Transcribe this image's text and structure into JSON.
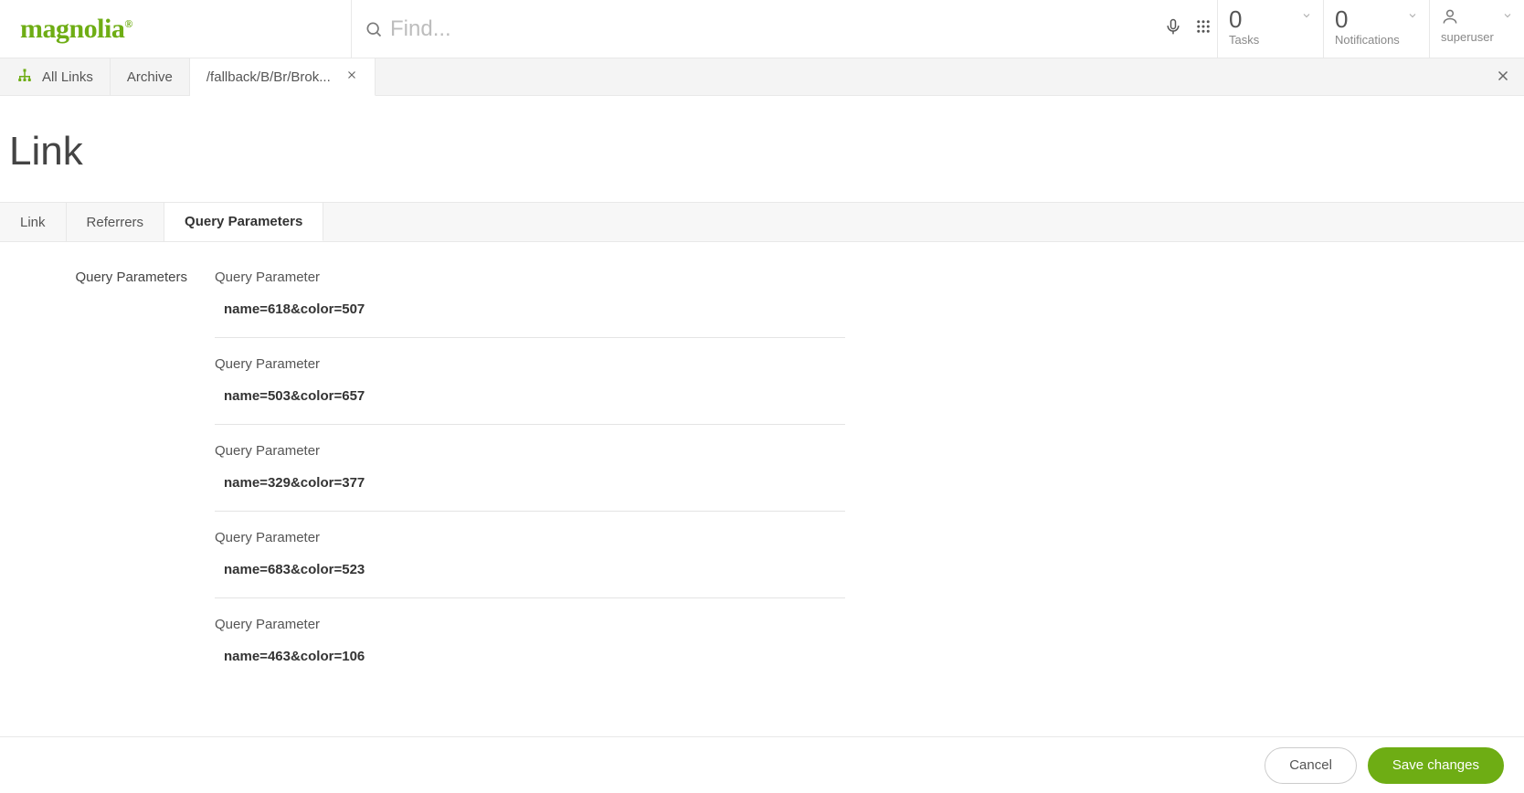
{
  "header": {
    "logo_text": "magnolia",
    "find_placeholder": "Find...",
    "tasks": {
      "count": "0",
      "label": "Tasks"
    },
    "notifications": {
      "count": "0",
      "label": "Notifications"
    },
    "user": {
      "label": "superuser"
    }
  },
  "main_tabs": [
    {
      "label": "All Links",
      "icon": "tree"
    },
    {
      "label": "Archive"
    },
    {
      "label": "/fallback/B/Br/Brok...",
      "active": true,
      "closable": true
    }
  ],
  "page": {
    "title": "Link",
    "subtabs": [
      {
        "label": "Link"
      },
      {
        "label": "Referrers"
      },
      {
        "label": "Query Parameters",
        "active": true
      }
    ],
    "params_section_label": "Query Parameters",
    "param_item_label": "Query Parameter",
    "params": [
      {
        "value": "name=618&color=507"
      },
      {
        "value": "name=503&color=657"
      },
      {
        "value": "name=329&color=377"
      },
      {
        "value": "name=683&color=523"
      },
      {
        "value": "name=463&color=106"
      }
    ]
  },
  "footer": {
    "cancel": "Cancel",
    "save": "Save changes"
  }
}
